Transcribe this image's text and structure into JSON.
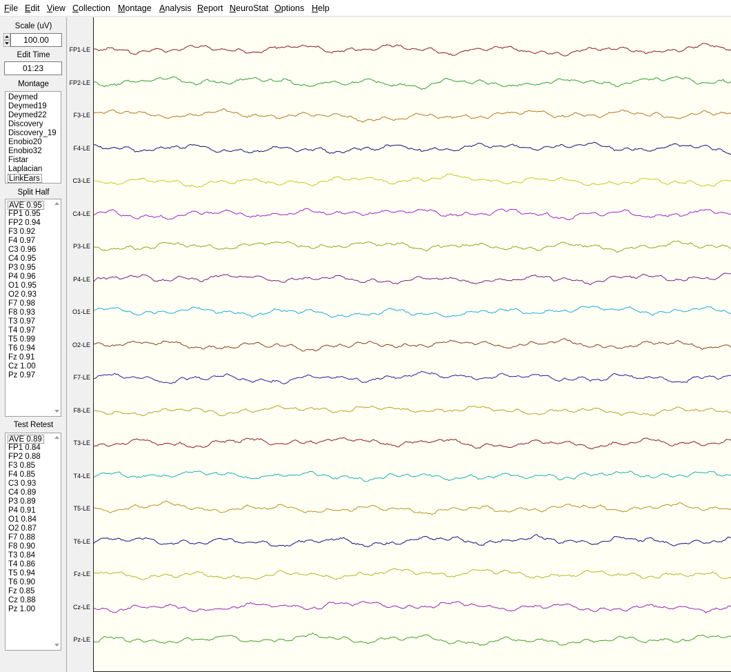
{
  "menu": [
    {
      "label": "File",
      "u": "F"
    },
    {
      "label": "Edit",
      "u": "E"
    },
    {
      "label": "View",
      "u": "V"
    },
    {
      "label": "Collection",
      "u": "C"
    },
    {
      "label": "Montage",
      "u": "M"
    },
    {
      "label": "Analysis",
      "u": "A"
    },
    {
      "label": "Report",
      "u": "R"
    },
    {
      "label": "NeuroStat",
      "u": "N"
    },
    {
      "label": "Options",
      "u": "O"
    },
    {
      "label": "Help",
      "u": "H"
    }
  ],
  "panel": {
    "scale_label": "Scale (uV)",
    "scale_value": "100.00",
    "edit_time_label": "Edit Time",
    "edit_time_value": "01:23",
    "montage_label": "Montage",
    "montage_items": [
      "Deymed",
      "Deymed19",
      "Deymed22",
      "Discovery",
      "Discovery_19",
      "Enobio20",
      "Enobio32",
      "Fistar",
      "Laplacian",
      "LinkEars"
    ],
    "montage_selected": "LinkEars",
    "split_half_label": "Split Half",
    "split_half_items": [
      "AVE  0.95",
      "FP1  0.95",
      "FP2  0.94",
      "F3  0.92",
      "F4  0.97",
      "C3  0.96",
      "C4  0.95",
      "P3  0.95",
      "P4  0.96",
      "O1  0.95",
      "O2  0.93",
      "F7  0.98",
      "F8  0.93",
      "T3  0.97",
      "T4  0.97",
      "T5  0.99",
      "T6  0.94",
      "Fz  0.91",
      "Cz  1.00",
      "Pz  0.97"
    ],
    "test_retest_label": "Test Retest",
    "test_retest_items": [
      "AVE  0.89",
      "FP1  0.84",
      "FP2  0.88",
      "F3  0.85",
      "F4  0.85",
      "C3  0.93",
      "C4  0.89",
      "P3  0.89",
      "P4  0.91",
      "O1  0.84",
      "O2  0.87",
      "F7  0.88",
      "F8  0.90",
      "T3  0.84",
      "T4  0.86",
      "T5  0.94",
      "T6  0.90",
      "Fz  0.85",
      "Cz  0.88",
      "Pz  1.00"
    ]
  },
  "channels": [
    {
      "label": "FP1-LE",
      "color": "#8b1a1a"
    },
    {
      "label": "FP2-LE",
      "color": "#2ca02c"
    },
    {
      "label": "F3-LE",
      "color": "#b8741a"
    },
    {
      "label": "F4-LE",
      "color": "#101070"
    },
    {
      "label": "C3-LE",
      "color": "#c8c81e"
    },
    {
      "label": "C4-LE",
      "color": "#a020c0"
    },
    {
      "label": "P3-LE",
      "color": "#8aaa18"
    },
    {
      "label": "P4-LE",
      "color": "#7a1a7a"
    },
    {
      "label": "O1-LE",
      "color": "#1aa8e0"
    },
    {
      "label": "O2-LE",
      "color": "#8b3a1a"
    },
    {
      "label": "F7-LE",
      "color": "#2a1a9a"
    },
    {
      "label": "F8-LE",
      "color": "#b8a020"
    },
    {
      "label": "T3-LE",
      "color": "#901818"
    },
    {
      "label": "T4-LE",
      "color": "#18b0a8"
    },
    {
      "label": "T5-LE",
      "color": "#b89018"
    },
    {
      "label": "T6-LE",
      "color": "#101080"
    },
    {
      "label": "Fz-LE",
      "color": "#b0b820"
    },
    {
      "label": "Cz-LE",
      "color": "#9a20b0"
    },
    {
      "label": "Pz-LE",
      "color": "#40a020"
    }
  ]
}
